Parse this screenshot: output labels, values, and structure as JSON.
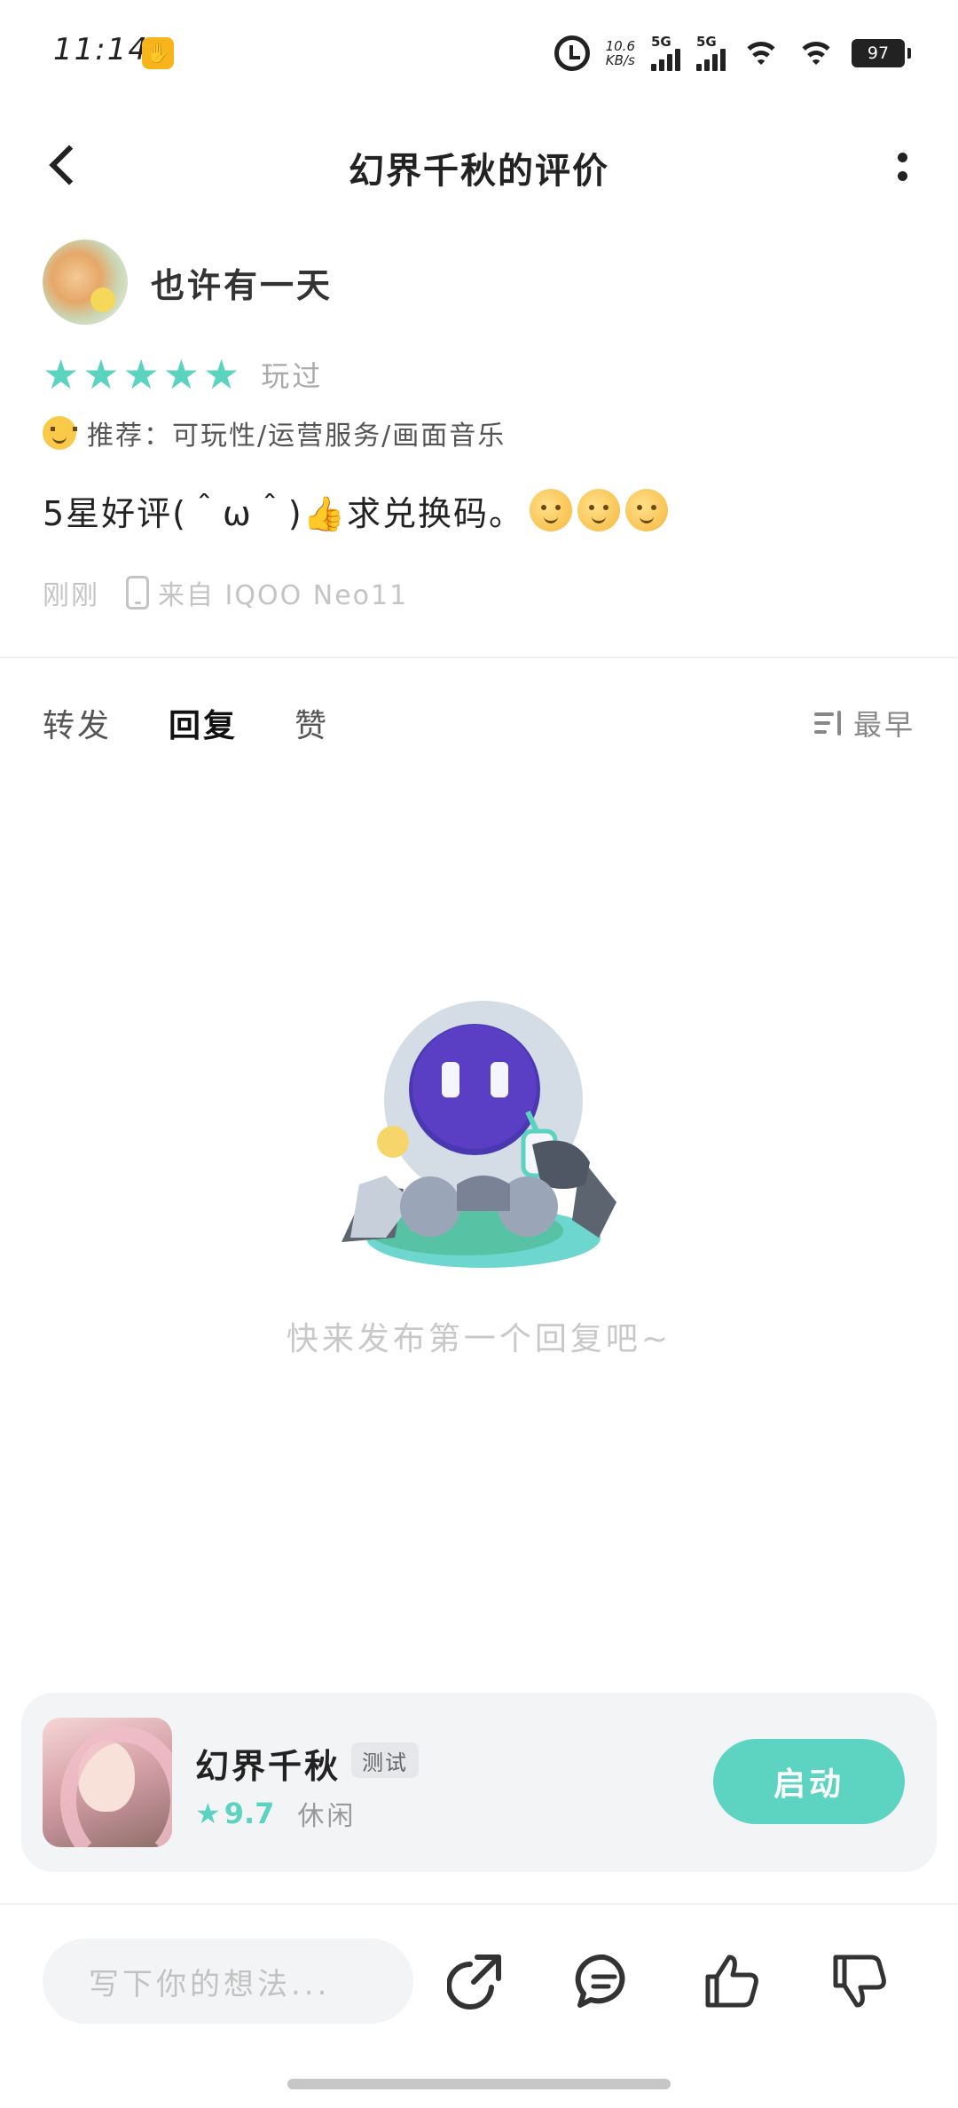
{
  "status_bar": {
    "time": "11:14",
    "net_speed_value": "10.6",
    "net_speed_unit": "KB/s",
    "sim1_label": "5G",
    "sim2_label": "5G",
    "battery": "97"
  },
  "header": {
    "title": "幻界千秋的评价"
  },
  "review": {
    "author_name": "也许有一天",
    "stars": 5,
    "played_label": "玩过",
    "recommend_text": "推荐：可玩性/运营服务/画面音乐",
    "content_text": "5星好评(＾ω＾)👍求兑换码。",
    "content_emoji_count": 3,
    "time_label": "刚刚",
    "device_label": "来自 IQOO Neo11"
  },
  "tabs": {
    "items": [
      "转发",
      "回复",
      "赞"
    ],
    "active_index": 1,
    "sort_label": "最早"
  },
  "empty_state": {
    "message": "快来发布第一个回复吧~"
  },
  "game_card": {
    "name": "幻界千秋",
    "badge": "测试",
    "score": "9.7",
    "genre": "休闲",
    "launch_label": "启动"
  },
  "bottom_bar": {
    "input_placeholder": "写下你的想法..."
  },
  "colors": {
    "accent": "#5bd3c1",
    "launch_button": "#5dd4c2",
    "card_background": "#f3f4f6"
  }
}
